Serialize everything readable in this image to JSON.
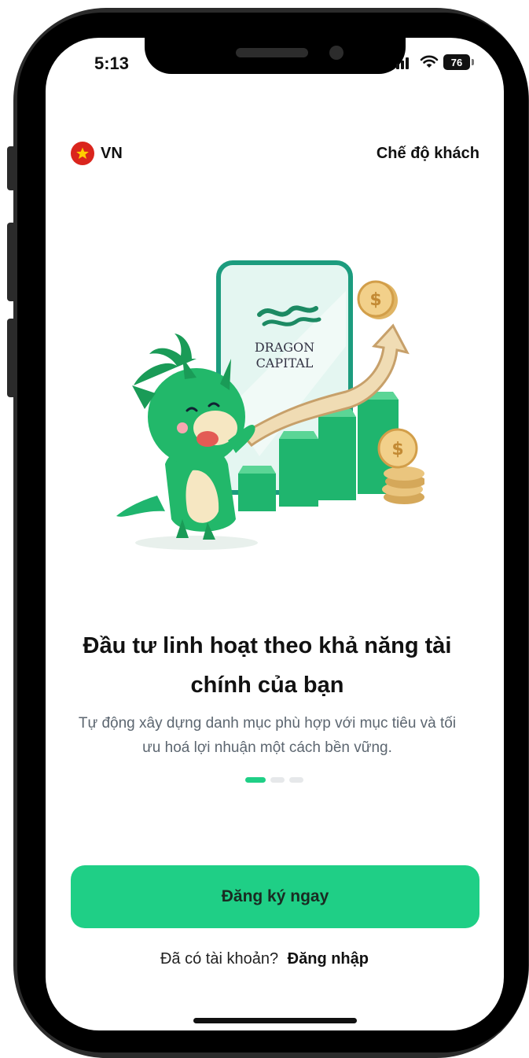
{
  "status": {
    "time": "5:13",
    "battery": "76",
    "signal_icon": "signal-bars-icon",
    "wifi_icon": "wifi-icon"
  },
  "header": {
    "language": "VN",
    "flag_icon": "vietnam-flag-icon",
    "guest_mode": "Chế độ khách"
  },
  "illustration": {
    "logo_line1": "DRAGON",
    "logo_line2": "CAPITAL"
  },
  "onboarding": {
    "title": "Đầu tư linh hoạt theo khả năng tài chính của bạn",
    "subtitle": "Tự động xây dựng danh mục phù hợp với mục tiêu và tối ưu hoá lợi nhuận một cách bền vững.",
    "page_index": 1,
    "page_count": 3
  },
  "actions": {
    "register_label": "Đăng ký ngay",
    "have_account": "Đã có tài khoản?",
    "login_label": "Đăng nhập"
  },
  "colors": {
    "accent": "#1fcf86",
    "flag_red": "#da251d",
    "flag_star": "#ffcd00"
  }
}
